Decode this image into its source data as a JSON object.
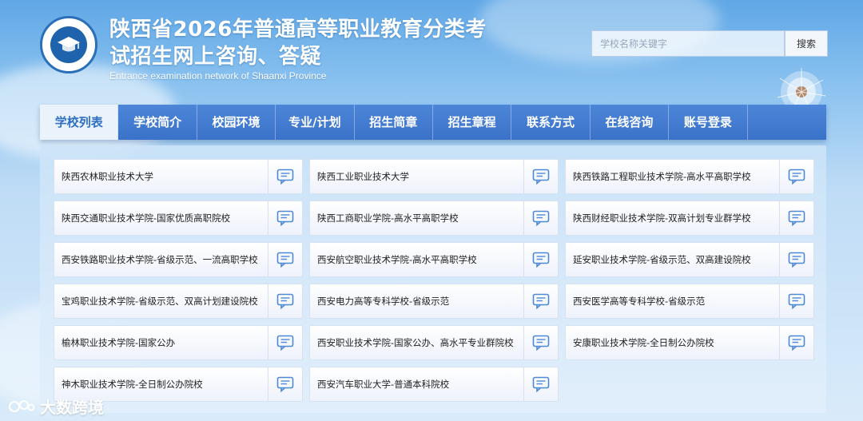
{
  "header": {
    "title_line1": "陕西省2026年普通高等职业教育分类考",
    "title_line2": "试招生网上咨询、答疑",
    "subtitle": "Entrance examination network of Shaanxi Province"
  },
  "search": {
    "placeholder": "学校名称关键字",
    "button_label": "搜索"
  },
  "nav": {
    "items": [
      {
        "label": "学校列表",
        "active": true
      },
      {
        "label": "学校简介"
      },
      {
        "label": "校园环境"
      },
      {
        "label": "专业/计划"
      },
      {
        "label": "招生简章"
      },
      {
        "label": "招生章程"
      },
      {
        "label": "联系方式"
      },
      {
        "label": "在线咨询"
      },
      {
        "label": "账号登录"
      }
    ]
  },
  "schools": [
    "陕西农林职业技术大学",
    "陕西工业职业技术大学",
    "陕西铁路工程职业技术学院-高水平高职学校",
    "陕西交通职业技术学院-国家优质高职院校",
    "陕西工商职业学院-高水平高职学校",
    "陕西财经职业技术学院-双高计划专业群学校",
    "西安铁路职业技术学院-省级示范、一流高职学校",
    "西安航空职业技术学院-高水平高职学校",
    "延安职业技术学院-省级示范、双高建设院校",
    "宝鸡职业技术学院-省级示范、双高计划建设院校",
    "西安电力高等专科学校-省级示范",
    "西安医学高等专科学校-省级示范",
    "榆林职业技术学院-国家公办",
    "西安职业技术学院-国家公办、高水平专业群院校",
    "安康职业技术学院-全日制公办院校",
    "神木职业技术学院-全日制公办院校",
    "西安汽车职业大学-普通本科院校"
  ],
  "icons": {
    "card_action": "chat-bubble-icon",
    "logo": "graduation-cap-icon"
  },
  "watermark": {
    "text": "大数跨境"
  },
  "colors": {
    "nav_bg": "#3a72c9",
    "nav_active_text": "#2f6fc4",
    "icon": "#4d8ad6"
  }
}
